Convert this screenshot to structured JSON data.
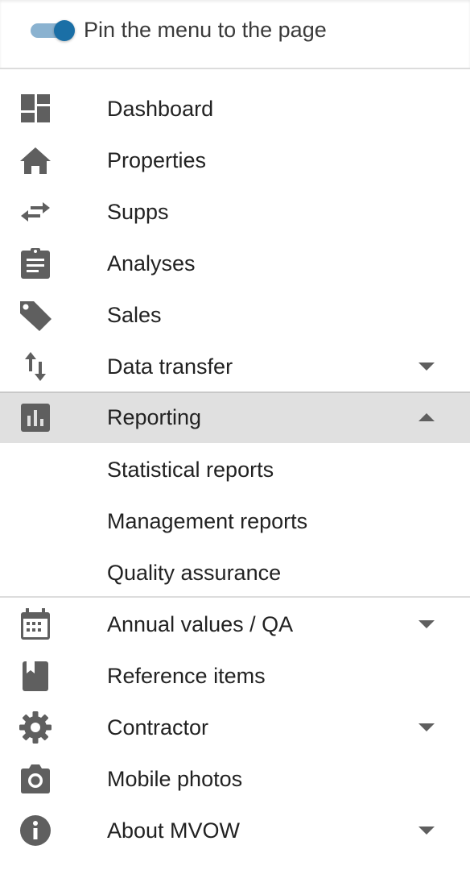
{
  "header": {
    "pin_label": "Pin the menu to the page",
    "pin_enabled": true
  },
  "colors": {
    "toggle_track": "#8ab2d0",
    "toggle_knob": "#1a6fa6",
    "icon": "#5f5f5f",
    "active_bg": "#e0e0e0"
  },
  "menu": {
    "items": [
      {
        "label": "Dashboard",
        "icon": "dashboard-icon"
      },
      {
        "label": "Properties",
        "icon": "home-icon"
      },
      {
        "label": "Supps",
        "icon": "swap-horizontal-icon"
      },
      {
        "label": "Analyses",
        "icon": "clipboard-icon"
      },
      {
        "label": "Sales",
        "icon": "tag-icon"
      },
      {
        "label": "Data transfer",
        "icon": "swap-vertical-icon",
        "expandable": true,
        "expanded": false
      },
      {
        "label": "Reporting",
        "icon": "bar-chart-icon",
        "expandable": true,
        "expanded": true,
        "active": true
      },
      {
        "label": "Annual values / QA",
        "icon": "calendar-icon",
        "expandable": true,
        "expanded": false
      },
      {
        "label": "Reference items",
        "icon": "bookmark-icon"
      },
      {
        "label": "Contractor",
        "icon": "gear-icon",
        "expandable": true,
        "expanded": false
      },
      {
        "label": "Mobile photos",
        "icon": "camera-icon"
      },
      {
        "label": "About MVOW",
        "icon": "info-icon",
        "expandable": true,
        "expanded": false
      }
    ],
    "reporting_sub": [
      {
        "label": "Statistical reports"
      },
      {
        "label": "Management reports"
      },
      {
        "label": "Quality assurance"
      }
    ]
  }
}
